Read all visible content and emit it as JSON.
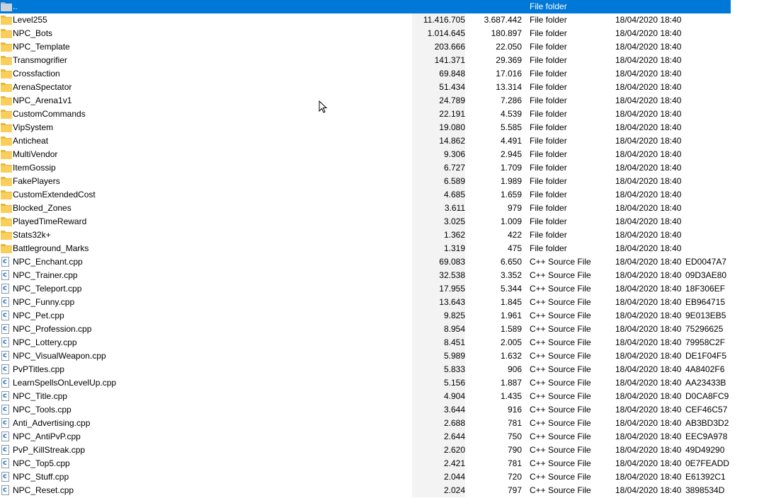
{
  "parent_row": {
    "name": "..",
    "type": "File folder"
  },
  "rows": [
    {
      "name": "Level255",
      "size": "11.416.705",
      "packed": "3.687.442",
      "type": "File folder",
      "modified": "18/04/2020 18:40",
      "crc": "",
      "icon": "folder-icon"
    },
    {
      "name": "NPC_Bots",
      "size": "1.014.645",
      "packed": "180.897",
      "type": "File folder",
      "modified": "18/04/2020 18:40",
      "crc": "",
      "icon": "folder-icon"
    },
    {
      "name": "NPC_Template",
      "size": "203.666",
      "packed": "22.050",
      "type": "File folder",
      "modified": "18/04/2020 18:40",
      "crc": "",
      "icon": "folder-icon"
    },
    {
      "name": "Transmogrifier",
      "size": "141.371",
      "packed": "29.369",
      "type": "File folder",
      "modified": "18/04/2020 18:40",
      "crc": "",
      "icon": "folder-icon"
    },
    {
      "name": "Crossfaction",
      "size": "69.848",
      "packed": "17.016",
      "type": "File folder",
      "modified": "18/04/2020 18:40",
      "crc": "",
      "icon": "folder-icon"
    },
    {
      "name": "ArenaSpectator",
      "size": "51.434",
      "packed": "13.314",
      "type": "File folder",
      "modified": "18/04/2020 18:40",
      "crc": "",
      "icon": "folder-icon"
    },
    {
      "name": "NPC_Arena1v1",
      "size": "24.789",
      "packed": "7.286",
      "type": "File folder",
      "modified": "18/04/2020 18:40",
      "crc": "",
      "icon": "folder-icon"
    },
    {
      "name": "CustomCommands",
      "size": "22.191",
      "packed": "4.539",
      "type": "File folder",
      "modified": "18/04/2020 18:40",
      "crc": "",
      "icon": "folder-icon"
    },
    {
      "name": "VipSystem",
      "size": "19.080",
      "packed": "5.585",
      "type": "File folder",
      "modified": "18/04/2020 18:40",
      "crc": "",
      "icon": "folder-icon"
    },
    {
      "name": "Anticheat",
      "size": "14.862",
      "packed": "4.491",
      "type": "File folder",
      "modified": "18/04/2020 18:40",
      "crc": "",
      "icon": "folder-icon"
    },
    {
      "name": "MultiVendor",
      "size": "9.306",
      "packed": "2.945",
      "type": "File folder",
      "modified": "18/04/2020 18:40",
      "crc": "",
      "icon": "folder-icon"
    },
    {
      "name": "ItemGossip",
      "size": "6.727",
      "packed": "1.709",
      "type": "File folder",
      "modified": "18/04/2020 18:40",
      "crc": "",
      "icon": "folder-icon"
    },
    {
      "name": "FakePlayers",
      "size": "6.589",
      "packed": "1.989",
      "type": "File folder",
      "modified": "18/04/2020 18:40",
      "crc": "",
      "icon": "folder-icon"
    },
    {
      "name": "CustomExtendedCost",
      "size": "4.685",
      "packed": "1.659",
      "type": "File folder",
      "modified": "18/04/2020 18:40",
      "crc": "",
      "icon": "folder-icon"
    },
    {
      "name": "Blocked_Zones",
      "size": "3.611",
      "packed": "979",
      "type": "File folder",
      "modified": "18/04/2020 18:40",
      "crc": "",
      "icon": "folder-icon"
    },
    {
      "name": "PlayedTimeReward",
      "size": "3.025",
      "packed": "1.009",
      "type": "File folder",
      "modified": "18/04/2020 18:40",
      "crc": "",
      "icon": "folder-icon"
    },
    {
      "name": "Stats32k+",
      "size": "1.362",
      "packed": "422",
      "type": "File folder",
      "modified": "18/04/2020 18:40",
      "crc": "",
      "icon": "folder-icon"
    },
    {
      "name": "Battleground_Marks",
      "size": "1.319",
      "packed": "475",
      "type": "File folder",
      "modified": "18/04/2020 18:40",
      "crc": "",
      "icon": "folder-icon"
    },
    {
      "name": "NPC_Enchant.cpp",
      "size": "69.083",
      "packed": "6.650",
      "type": "C++ Source File",
      "modified": "18/04/2020 18:40",
      "crc": "ED0047A7",
      "icon": "cpp-file-icon"
    },
    {
      "name": "NPC_Trainer.cpp",
      "size": "32.538",
      "packed": "3.352",
      "type": "C++ Source File",
      "modified": "18/04/2020 18:40",
      "crc": "09D3AE80",
      "icon": "cpp-file-icon"
    },
    {
      "name": "NPC_Teleport.cpp",
      "size": "17.955",
      "packed": "5.344",
      "type": "C++ Source File",
      "modified": "18/04/2020 18:40",
      "crc": "18F306EF",
      "icon": "cpp-file-icon"
    },
    {
      "name": "NPC_Funny.cpp",
      "size": "13.643",
      "packed": "1.845",
      "type": "C++ Source File",
      "modified": "18/04/2020 18:40",
      "crc": "EB964715",
      "icon": "cpp-file-icon"
    },
    {
      "name": "NPC_Pet.cpp",
      "size": "9.825",
      "packed": "1.961",
      "type": "C++ Source File",
      "modified": "18/04/2020 18:40",
      "crc": "9E013EB5",
      "icon": "cpp-file-icon"
    },
    {
      "name": "NPC_Profession.cpp",
      "size": "8.954",
      "packed": "1.589",
      "type": "C++ Source File",
      "modified": "18/04/2020 18:40",
      "crc": "75296625",
      "icon": "cpp-file-icon"
    },
    {
      "name": "NPC_Lottery.cpp",
      "size": "8.451",
      "packed": "2.005",
      "type": "C++ Source File",
      "modified": "18/04/2020 18:40",
      "crc": "79958C2F",
      "icon": "cpp-file-icon"
    },
    {
      "name": "NPC_VisualWeapon.cpp",
      "size": "5.989",
      "packed": "1.632",
      "type": "C++ Source File",
      "modified": "18/04/2020 18:40",
      "crc": "DE1F04F5",
      "icon": "cpp-file-icon"
    },
    {
      "name": "PvPTitles.cpp",
      "size": "5.833",
      "packed": "906",
      "type": "C++ Source File",
      "modified": "18/04/2020 18:40",
      "crc": "4A8402F6",
      "icon": "cpp-file-icon"
    },
    {
      "name": "LearnSpellsOnLevelUp.cpp",
      "size": "5.156",
      "packed": "1.887",
      "type": "C++ Source File",
      "modified": "18/04/2020 18:40",
      "crc": "AA23433B",
      "icon": "cpp-file-icon"
    },
    {
      "name": "NPC_Title.cpp",
      "size": "4.904",
      "packed": "1.435",
      "type": "C++ Source File",
      "modified": "18/04/2020 18:40",
      "crc": "D0CA8FC9",
      "icon": "cpp-file-icon"
    },
    {
      "name": "NPC_Tools.cpp",
      "size": "3.644",
      "packed": "916",
      "type": "C++ Source File",
      "modified": "18/04/2020 18:40",
      "crc": "CEF46C57",
      "icon": "cpp-file-icon"
    },
    {
      "name": "Anti_Advertising.cpp",
      "size": "2.688",
      "packed": "781",
      "type": "C++ Source File",
      "modified": "18/04/2020 18:40",
      "crc": "AB3BD3D2",
      "icon": "cpp-file-icon"
    },
    {
      "name": "NPC_AntiPvP.cpp",
      "size": "2.644",
      "packed": "750",
      "type": "C++ Source File",
      "modified": "18/04/2020 18:40",
      "crc": "EEC9A978",
      "icon": "cpp-file-icon"
    },
    {
      "name": "PvP_KillStreak.cpp",
      "size": "2.620",
      "packed": "790",
      "type": "C++ Source File",
      "modified": "18/04/2020 18:40",
      "crc": "49D49290",
      "icon": "cpp-file-icon"
    },
    {
      "name": "NPC_Top5.cpp",
      "size": "2.421",
      "packed": "781",
      "type": "C++ Source File",
      "modified": "18/04/2020 18:40",
      "crc": "0E7FEADD",
      "icon": "cpp-file-icon"
    },
    {
      "name": "NPC_Stuff.cpp",
      "size": "2.044",
      "packed": "720",
      "type": "C++ Source File",
      "modified": "18/04/2020 18:40",
      "crc": "E61392C1",
      "icon": "cpp-file-icon"
    },
    {
      "name": "NPC_Reset.cpp",
      "size": "2.024",
      "packed": "797",
      "type": "C++ Source File",
      "modified": "18/04/2020 18:40",
      "crc": "3898534D",
      "icon": "cpp-file-icon"
    }
  ],
  "colors": {
    "selection": "#0078d7",
    "size_column_bg": "#f3f3f3",
    "folder": "#f8cf5c"
  },
  "cursor": {
    "icon": "mouse-pointer-icon"
  }
}
